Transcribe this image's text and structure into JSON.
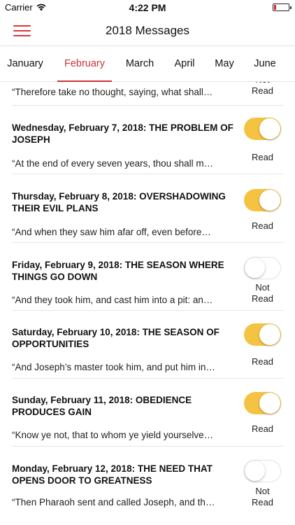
{
  "status_bar": {
    "carrier": "Carrier",
    "time": "4:22 PM"
  },
  "nav": {
    "title": "2018 Messages"
  },
  "tabs": [
    {
      "label": "January"
    },
    {
      "label": "February"
    },
    {
      "label": "March"
    },
    {
      "label": "April"
    },
    {
      "label": "May"
    },
    {
      "label": "June"
    }
  ],
  "active_tab": "February",
  "accent_color": "#c8343c",
  "toggle_on_color": "#f5c342",
  "messages": [
    {
      "title": "",
      "preview": "“Therefore take no thought, saying, what shall…",
      "read": false,
      "status": "Not Read"
    },
    {
      "title": "Wednesday, February 7, 2018: THE PROBLEM OF JOSEPH",
      "preview": "“At the end of every seven years, thou shall m…",
      "read": true,
      "status": "Read"
    },
    {
      "title": "Thursday, February 8, 2018: OVERSHADOWING THEIR EVIL PLANS",
      "preview": "“And when they saw him afar off, even before…",
      "read": true,
      "status": "Read"
    },
    {
      "title": "Friday, February 9, 2018: THE SEASON WHERE THINGS GO DOWN",
      "preview": "“And they took him, and cast him into a pit: an…",
      "read": false,
      "status": "Not Read"
    },
    {
      "title": "Saturday, February 10, 2018: THE SEASON OF OPPORTUNITIES",
      "preview": "“And Joseph’s master took him, and put him in…",
      "read": true,
      "status": "Read"
    },
    {
      "title": "Sunday, February 11, 2018: OBEDIENCE PRODUCES GAIN",
      "preview": "“Know ye not, that to whom ye yield yourselve…",
      "read": true,
      "status": "Read"
    },
    {
      "title": "Monday, February 12, 2018: THE NEED THAT OPENS DOOR TO GREATNESS",
      "preview": "“Then Pharaoh sent and called Joseph, and th…",
      "read": false,
      "status": "Not Read"
    }
  ]
}
